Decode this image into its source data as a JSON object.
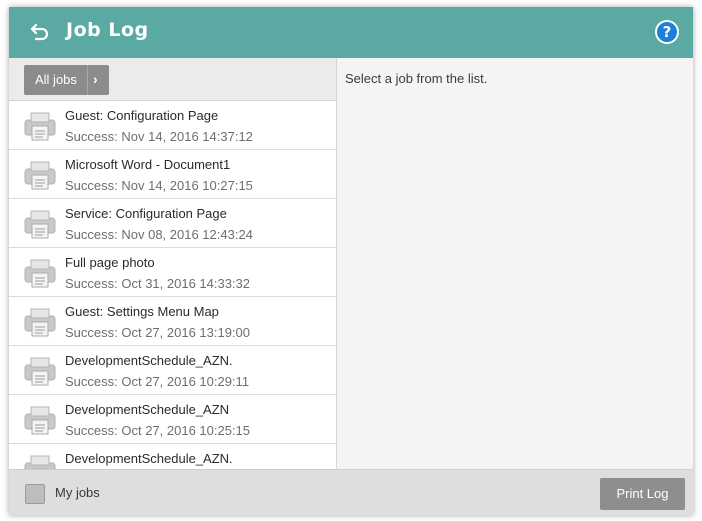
{
  "header": {
    "title": "Job Log",
    "help_glyph": "?",
    "back_icon": "back-arrow-icon",
    "help_icon": "help-icon",
    "color": "#5aa9a3"
  },
  "filter": {
    "label": "All jobs",
    "chevron": "›"
  },
  "jobs": [
    {
      "name": "Guest: Configuration Page",
      "status": "Success: Nov 14, 2016 14:37:12"
    },
    {
      "name": "Microsoft Word - Document1",
      "status": "Success: Nov 14, 2016 10:27:15"
    },
    {
      "name": "Service: Configuration Page",
      "status": "Success: Nov 08, 2016 12:43:24"
    },
    {
      "name": "Full page photo",
      "status": "Success: Oct 31, 2016 14:33:32"
    },
    {
      "name": "Guest: Settings Menu Map",
      "status": "Success: Oct 27, 2016 13:19:00"
    },
    {
      "name": "DevelopmentSchedule_AZN.",
      "status": "Success: Oct 27, 2016 10:29:11"
    },
    {
      "name": "DevelopmentSchedule_AZN",
      "status": "Success: Oct 27, 2016 10:25:15"
    },
    {
      "name": "DevelopmentSchedule_AZN.",
      "status": ""
    }
  ],
  "detail": {
    "prompt": "Select a job from the list."
  },
  "footer": {
    "my_jobs_label": "My jobs",
    "my_jobs_checked": false,
    "print_log_label": "Print Log"
  }
}
